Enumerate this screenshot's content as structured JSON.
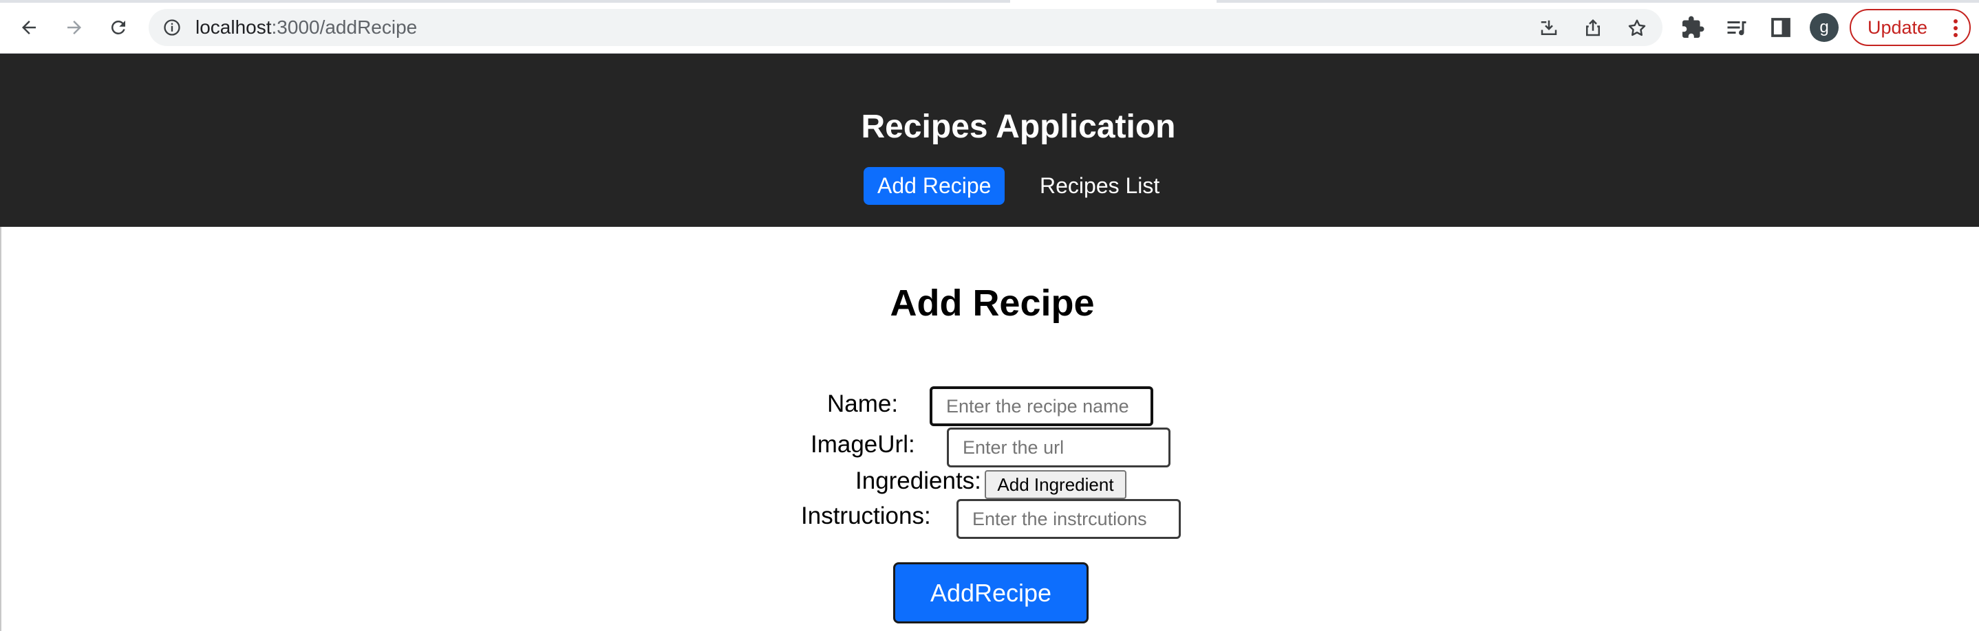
{
  "browser": {
    "url_host": "localhost",
    "url_path": ":3000/addRecipe",
    "profile_initial": "g",
    "update_label": "Update"
  },
  "app": {
    "title": "Recipes Application",
    "nav": [
      {
        "label": "Add Recipe",
        "active": true
      },
      {
        "label": "Recipes List",
        "active": false
      }
    ]
  },
  "form": {
    "heading": "Add Recipe",
    "name_label": "Name:",
    "name_placeholder": "Enter the recipe name",
    "image_label": "ImageUrl:",
    "image_placeholder": "Enter the url",
    "ingredients_label": "Ingredients:",
    "add_ingredient_label": "Add Ingredient",
    "instructions_label": "Instructions:",
    "instructions_placeholder": "Enter the instrcutions",
    "submit_label": "AddRecipe"
  },
  "colors": {
    "header_bg": "#252525",
    "accent": "#0d6efd",
    "update_red": "#c5221f"
  }
}
